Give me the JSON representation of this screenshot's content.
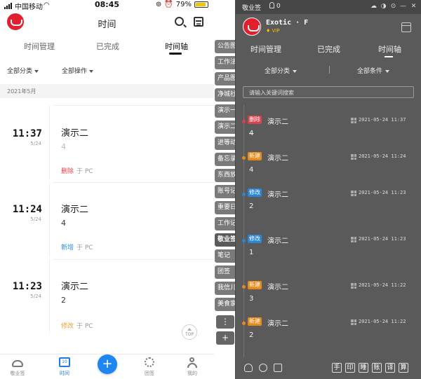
{
  "phone": {
    "status": {
      "carrier": "中国移动",
      "time": "08:45",
      "battery": "79%"
    },
    "header": {
      "title": "时间"
    },
    "tabs": [
      {
        "label": "时间管理",
        "active": false
      },
      {
        "label": "已完成",
        "active": false
      },
      {
        "label": "时间轴",
        "active": true
      }
    ],
    "filters": {
      "category": "全部分类",
      "operation": "全部操作"
    },
    "month": "2021年5月",
    "entries": [
      {
        "time": "11:37",
        "date": "5/24",
        "name": "演示二",
        "content": "4",
        "action": "删除",
        "source": "于 PC",
        "content_color": "#bbbbbb",
        "action_color": "#e0474c"
      },
      {
        "time": "11:24",
        "date": "5/24",
        "name": "演示二",
        "content": "4",
        "action": "新增",
        "source": "于 PC",
        "content_color": "#333333",
        "action_color": "#2d8ee8"
      },
      {
        "time": "11:23",
        "date": "5/24",
        "name": "演示二",
        "content": "2",
        "action": "修改",
        "source": "于 PC",
        "content_color": "#333333",
        "action_color": "#f0a030"
      }
    ],
    "top_button": "TOP",
    "bottom_nav": [
      {
        "label": "敬业签",
        "active": false
      },
      {
        "label": "时间",
        "active": true
      },
      {
        "label": "团签",
        "active": false
      },
      {
        "label": "我的",
        "active": false
      }
    ],
    "add_button": "+"
  },
  "strip": {
    "tabs": [
      "公告图",
      "工作法",
      "产品图",
      "净城社",
      "演示一",
      "演示二",
      "进等动",
      "备忘录",
      "东西放",
      "账号记",
      "重要日",
      "工作记",
      "敬业签",
      "笔记",
      "团签",
      "我信儿",
      "美食家"
    ],
    "active_index": 12,
    "more_button": "⋮",
    "add_button": "+"
  },
  "app": {
    "titlebar": {
      "name": "敬业签",
      "count": "0"
    },
    "user": {
      "name": "Exotic · F",
      "vip": "VIP"
    },
    "tabs": [
      {
        "label": "时间管理",
        "active": false
      },
      {
        "label": "已完成",
        "active": false
      },
      {
        "label": "时间轴",
        "active": true
      }
    ],
    "filters": {
      "category": "全部分类",
      "condition": "全部条件"
    },
    "search_placeholder": "请输入关键词搜索",
    "entries": [
      {
        "badge": "删除",
        "badge_color": "#d9414b",
        "name": "演示二",
        "time": "2021-05-24 11:37",
        "content": "4",
        "strike": true
      },
      {
        "badge": "新建",
        "badge_color": "#e88a1a",
        "name": "演示二",
        "time": "2021-05-24 11:24",
        "content": "4",
        "strike": false
      },
      {
        "badge": "修改",
        "badge_color": "#2a86d6",
        "name": "演示二",
        "time": "2021-05-24 11:23",
        "content": "2",
        "strike": false
      },
      {
        "badge": "修改",
        "badge_color": "#2a86d6",
        "name": "演示二",
        "time": "2021-05-24 11:23",
        "content": "1",
        "strike": false
      },
      {
        "badge": "新建",
        "badge_color": "#e88a1a",
        "name": "演示二",
        "time": "2021-05-24 11:22",
        "content": "3",
        "strike": false
      },
      {
        "badge": "新建",
        "badge_color": "#e88a1a",
        "name": "演示二",
        "time": "2021-05-24 11:22",
        "content": "2",
        "strike": false
      }
    ],
    "bottom_buttons": [
      "手",
      "印",
      "睡",
      "账",
      "译",
      "算"
    ]
  }
}
